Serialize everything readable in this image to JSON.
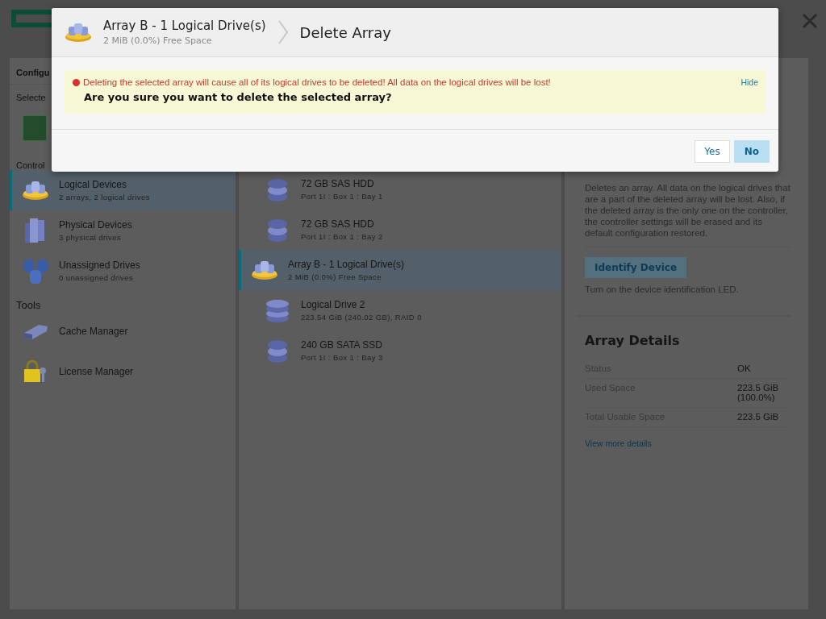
{
  "sidebar": {
    "title": "Configu",
    "selected_heading": "Selecte",
    "sections": [
      {
        "heading": "Control",
        "items": [
          {
            "kind": "array",
            "label": "Logical Devices",
            "sub": "2 arrays, 2 logical drives",
            "selected": true
          },
          {
            "kind": "physical",
            "label": "Physical Devices",
            "sub": "3 physical drives",
            "selected": false
          },
          {
            "kind": "unassigned",
            "label": "Unassigned Drives",
            "sub": "0 unassigned drives",
            "selected": false
          }
        ]
      },
      {
        "heading": "Tools",
        "items": [
          {
            "kind": "cache",
            "label": "Cache Manager",
            "selected": false
          },
          {
            "kind": "license",
            "label": "License Manager",
            "selected": false
          }
        ]
      }
    ]
  },
  "devices": [
    {
      "kind": "hdd",
      "label": "72 GB SAS HDD",
      "sub": "Port 1I : Box 1 : Bay 1",
      "selected": false
    },
    {
      "kind": "hdd",
      "label": "72 GB SAS HDD",
      "sub": "Port 1I : Box 1 : Bay 2",
      "selected": false
    },
    {
      "kind": "array",
      "label": "Array B - 1 Logical Drive(s)",
      "sub": "2 MiB (0.0%) Free Space",
      "selected": true
    },
    {
      "kind": "logical",
      "label": "Logical Drive 2",
      "sub": "223.54 GiB (240.02 GB), RAID 0",
      "selected": false
    },
    {
      "kind": "hdd",
      "label": "240 GB SATA SSD",
      "sub": "Port 1I : Box 1 : Bay 3",
      "selected": false
    }
  ],
  "actions": {
    "description": "Deletes an array. All data on the logical drives that are a part of the deleted array will be lost. Also, if the deleted array is the only one on the controller, the controller settings will be erased and its default configuration restored.",
    "button": "Identify Device",
    "button_description": "Turn on the device identification LED."
  },
  "details": {
    "title": "Array Details",
    "rows": [
      {
        "label": "Status",
        "value": "OK"
      },
      {
        "label": "Used Space",
        "value": "223.5 GiB (100.0%)"
      },
      {
        "label": "Total Usable Space",
        "value": "223.5 GiB"
      }
    ],
    "link": "View more details"
  },
  "dialog": {
    "title": "Array B - 1 Logical Drive(s)",
    "subtitle": "2 MiB (0.0%) Free Space",
    "breadcrumb": "Delete Array",
    "alert": {
      "message": "Deleting the selected array will cause all of its logical drives to be deleted! All data on the logical drives will be lost!",
      "question": "Are you sure you want to delete the selected array?",
      "hide": "Hide"
    },
    "buttons": [
      {
        "label": "Yes",
        "primary": false
      },
      {
        "label": "No",
        "primary": true
      }
    ]
  }
}
